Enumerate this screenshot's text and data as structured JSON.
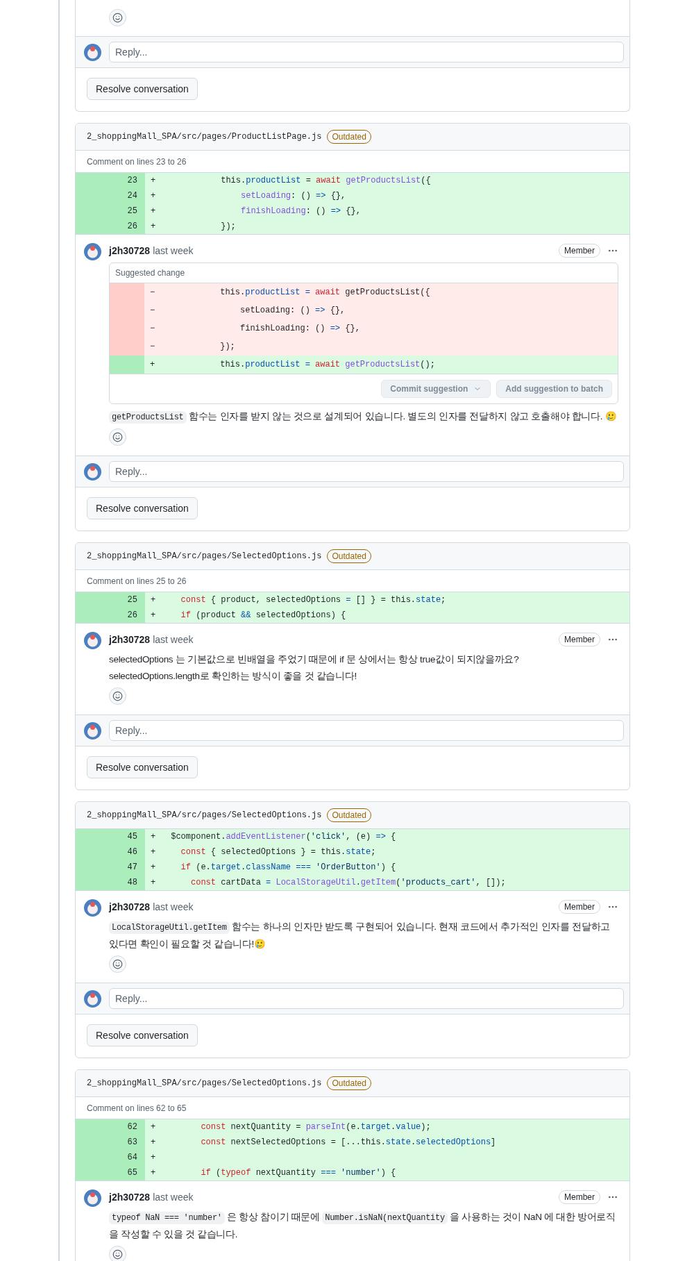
{
  "threads": [
    {
      "kind": "tail",
      "reply_placeholder": "Reply...",
      "resolve": "Resolve conversation"
    },
    {
      "kind": "full",
      "path": "2_shoppingMall_SPA/src/pages/ProductListPage.js",
      "badge": "Outdated",
      "range": "Comment on lines 23 to 26",
      "lines": [
        {
          "num": "23",
          "sign": "+",
          "tokens": [
            {
              "t": "           this."
            },
            {
              "t": "productList",
              "kind": "prop"
            },
            {
              "t": " = "
            },
            {
              "t": "await ",
              "kind": "kw"
            },
            {
              "t": "getProductsList",
              "kind": "fn"
            },
            {
              "t": "({"
            }
          ]
        },
        {
          "num": "24",
          "sign": "+",
          "tokens": [
            {
              "t": "               setLoading",
              "kind": "fn"
            },
            {
              "t": ": () "
            },
            {
              "t": "=>",
              "kind": "prop"
            },
            {
              "t": " {},"
            }
          ]
        },
        {
          "num": "25",
          "sign": "+",
          "tokens": [
            {
              "t": "               finishLoading",
              "kind": "fn"
            },
            {
              "t": ": () "
            },
            {
              "t": "=>",
              "kind": "prop"
            },
            {
              "t": " {},"
            }
          ]
        },
        {
          "num": "26",
          "sign": "+",
          "tokens": [
            {
              "t": "           });"
            }
          ]
        }
      ],
      "comment": {
        "author": "j2h30728",
        "time": "last week",
        "role": "Member",
        "suggestion": {
          "title": "Suggested change",
          "commit": "Commit suggestion",
          "batch": "Add suggestion to batch",
          "lines": [
            {
              "kind": "del",
              "sign": "−",
              "tokens": [
                {
                  "t": "           this."
                },
                {
                  "t": "productList",
                  "kind": "prop"
                },
                {
                  "t": " = ",
                  "kind": "prop"
                },
                {
                  "t": "await",
                  "kind": "kw"
                },
                {
                  "t": " getProductsList({"
                }
              ]
            },
            {
              "kind": "del",
              "sign": "−",
              "tokens": [
                {
                  "t": "               setLoading: () "
                },
                {
                  "t": "=>",
                  "kind": "prop"
                },
                {
                  "t": " {},"
                }
              ]
            },
            {
              "kind": "del",
              "sign": "−",
              "tokens": [
                {
                  "t": "               finishLoading: () "
                },
                {
                  "t": "=>",
                  "kind": "prop"
                },
                {
                  "t": " {},"
                }
              ]
            },
            {
              "kind": "del",
              "sign": "−",
              "tokens": [
                {
                  "t": "           });"
                }
              ]
            },
            {
              "kind": "add",
              "sign": "+",
              "tokens": [
                {
                  "t": "           this."
                },
                {
                  "t": "productList",
                  "kind": "prop"
                },
                {
                  "t": " = ",
                  "kind": "prop"
                },
                {
                  "t": "await ",
                  "kind": "kw"
                },
                {
                  "t": "getProductsList",
                  "kind": "fn"
                },
                {
                  "t": "();"
                }
              ]
            }
          ]
        },
        "body": [
          {
            "kind": "code",
            "text": "getProductsList"
          },
          {
            "kind": "text",
            "text": " 함수는 인자를 받지 않는 것으로 설계되어 있습니다. 별도의 인자를 전달하지 않고 호출해야 합니다. 🥲"
          }
        ]
      },
      "reply_placeholder": "Reply...",
      "resolve": "Resolve conversation"
    },
    {
      "kind": "full",
      "path": "2_shoppingMall_SPA/src/pages/SelectedOptions.js",
      "badge": "Outdated",
      "range": "Comment on lines 25 to 26",
      "lines": [
        {
          "num": "25",
          "sign": "+",
          "tokens": [
            {
              "t": "   const",
              "kind": "kw"
            },
            {
              "t": " { product, selectedOptions "
            },
            {
              "t": "=",
              "kind": "prop"
            },
            {
              "t": " [] } = this."
            },
            {
              "t": "state",
              "kind": "prop"
            },
            {
              "t": ";"
            }
          ]
        },
        {
          "num": "26",
          "sign": "+",
          "tokens": [
            {
              "t": "   if",
              "kind": "kw"
            },
            {
              "t": " (product "
            },
            {
              "t": "&&",
              "kind": "prop"
            },
            {
              "t": " selectedOptions) {"
            }
          ]
        }
      ],
      "comment": {
        "author": "j2h30728",
        "time": "last week",
        "role": "Member",
        "body": [
          {
            "kind": "text",
            "text": "selectedOptions 는 기본값으로 빈배열을 주었기 때문에 if 문 상에서는 항상 true값이 되지않을까요?\nselectedOptions.length로 확인하는 방식이 좋을 것 같습니다!"
          }
        ]
      },
      "reply_placeholder": "Reply...",
      "resolve": "Resolve conversation"
    },
    {
      "kind": "full",
      "path": "2_shoppingMall_SPA/src/pages/SelectedOptions.js",
      "badge": "Outdated",
      "lines": [
        {
          "num": "45",
          "sign": "+",
          "tokens": [
            {
              "t": " $component."
            },
            {
              "t": "addEventListener",
              "kind": "fn"
            },
            {
              "t": "("
            },
            {
              "t": "'click'",
              "kind": "str"
            },
            {
              "t": ", (e) "
            },
            {
              "t": "=>",
              "kind": "prop"
            },
            {
              "t": " {"
            }
          ]
        },
        {
          "num": "46",
          "sign": "+",
          "tokens": [
            {
              "t": "   const",
              "kind": "kw"
            },
            {
              "t": " { selectedOptions } = this."
            },
            {
              "t": "state",
              "kind": "prop"
            },
            {
              "t": ";"
            }
          ]
        },
        {
          "num": "47",
          "sign": "+",
          "tokens": [
            {
              "t": "   if",
              "kind": "kw"
            },
            {
              "t": " (e."
            },
            {
              "t": "target",
              "kind": "prop"
            },
            {
              "t": "."
            },
            {
              "t": "className",
              "kind": "prop"
            },
            {
              "t": " === ",
              "kind": "prop"
            },
            {
              "t": "'OrderButton'",
              "kind": "str"
            },
            {
              "t": ") {"
            }
          ]
        },
        {
          "num": "48",
          "sign": "+",
          "tokens": [
            {
              "t": "     const",
              "kind": "kw"
            },
            {
              "t": " cartData "
            },
            {
              "t": "= ",
              "kind": "prop"
            },
            {
              "t": "LocalStorageUtil",
              "kind": "fn"
            },
            {
              "t": "."
            },
            {
              "t": "getItem",
              "kind": "fn"
            },
            {
              "t": "("
            },
            {
              "t": "'products_cart'",
              "kind": "str"
            },
            {
              "t": ", []);"
            }
          ]
        }
      ],
      "comment": {
        "author": "j2h30728",
        "time": "last week",
        "role": "Member",
        "body": [
          {
            "kind": "code",
            "text": "LocalStorageUtil.getItem"
          },
          {
            "kind": "text",
            "text": " 함수는 하나의 인자만 받도록 구현되어 있습니다. 현재 코드에서 추가적인 인자를 전달하고 있다면 확인이 필요할 것 같습니다!🥲"
          }
        ]
      },
      "reply_placeholder": "Reply...",
      "resolve": "Resolve conversation"
    },
    {
      "kind": "full",
      "path": "2_shoppingMall_SPA/src/pages/SelectedOptions.js",
      "badge": "Outdated",
      "range": "Comment on lines 62 to 65",
      "lines": [
        {
          "num": "62",
          "sign": "+",
          "tokens": [
            {
              "t": "       const",
              "kind": "kw"
            },
            {
              "t": " nextQuantity = "
            },
            {
              "t": "parseInt",
              "kind": "fn"
            },
            {
              "t": "(e."
            },
            {
              "t": "target",
              "kind": "prop"
            },
            {
              "t": "."
            },
            {
              "t": "value",
              "kind": "prop"
            },
            {
              "t": ");"
            }
          ]
        },
        {
          "num": "63",
          "sign": "+",
          "tokens": [
            {
              "t": "       const",
              "kind": "kw"
            },
            {
              "t": " nextSelectedOptions = [...this."
            },
            {
              "t": "state",
              "kind": "prop"
            },
            {
              "t": "."
            },
            {
              "t": "selectedOptions",
              "kind": "prop"
            },
            {
              "t": "]"
            }
          ]
        },
        {
          "num": "64",
          "sign": "+"
        },
        {
          "num": "65",
          "sign": "+",
          "tokens": [
            {
              "t": "       if",
              "kind": "kw"
            },
            {
              "t": " ("
            },
            {
              "t": "typeof",
              "kind": "kw"
            },
            {
              "t": " nextQuantity "
            },
            {
              "t": "=== ",
              "kind": "prop"
            },
            {
              "t": "'number'",
              "kind": "str"
            },
            {
              "t": ") {"
            }
          ]
        }
      ],
      "comment": {
        "author": "j2h30728",
        "time": "last week",
        "role": "Member",
        "body": [
          {
            "kind": "code",
            "text": "typeof NaN === 'number'"
          },
          {
            "kind": "text",
            "text": " 은 항상 참이기 때문에 "
          },
          {
            "kind": "code",
            "text": "Number.isNaN(nextQuantity"
          },
          {
            "kind": "text",
            "text": " 을 사용하는 것이 NaN 에 대한 방어로직을 작성할 수 있을 것 같습니다."
          }
        ]
      }
    }
  ]
}
